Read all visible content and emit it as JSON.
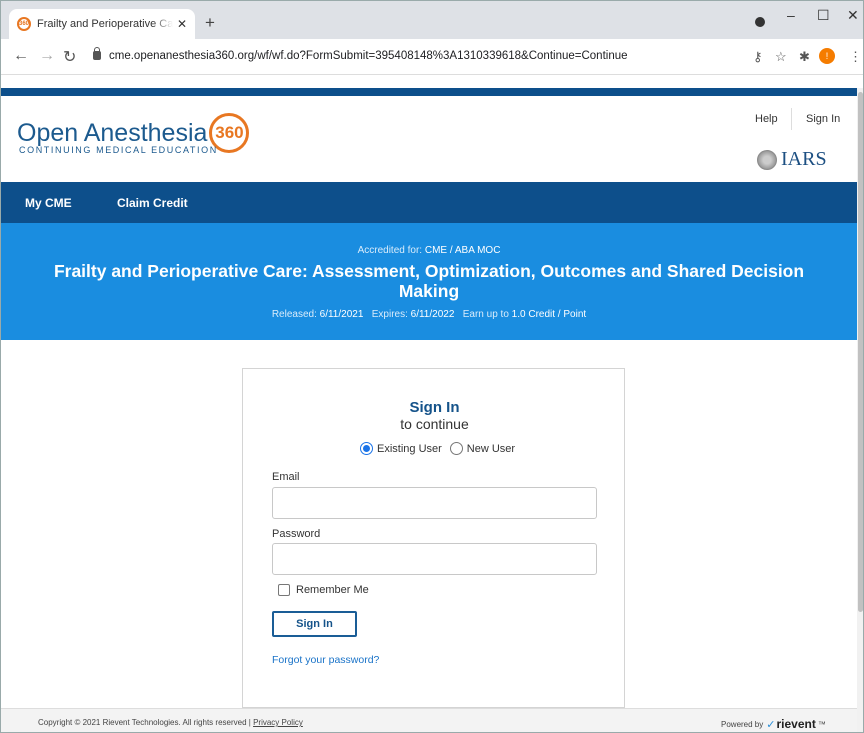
{
  "browser": {
    "tab_title": "Frailty and Perioperative Care: As",
    "tab_favicon_text": "360",
    "url": "cme.openanesthesia360.org/wf/wf.do?FormSubmit=395408148%3A1310339618&Continue=Continue",
    "profile_badge": "!",
    "window_controls": {
      "minimize": "–",
      "maximize": "☐",
      "close": "✕"
    }
  },
  "header": {
    "logo_text": "Open Anesthesia",
    "logo_badge": "360",
    "logo_subtitle": "CONTINUING MEDICAL EDUCATION",
    "help": "Help",
    "sign_in": "Sign In",
    "partner_logo": "IARS"
  },
  "nav": {
    "items": [
      "My CME",
      "Claim Credit"
    ]
  },
  "hero": {
    "accredited_label": "Accredited for:",
    "accredited_value": "CME / ABA MOC",
    "title": "Frailty and Perioperative Care: Assessment, Optimization, Outcomes and Shared Decision Making",
    "released_label": "Released:",
    "released_value": "6/11/2021",
    "expires_label": "Expires:",
    "expires_value": "6/11/2022",
    "earn_label": "Earn up to",
    "earn_value": "1.0 Credit / Point"
  },
  "signin": {
    "title": "Sign In",
    "subtitle": "to continue",
    "existing_user": "Existing User",
    "new_user": "New User",
    "email_label": "Email",
    "email_value": "",
    "password_label": "Password",
    "password_value": "",
    "remember_me": "Remember Me",
    "submit": "Sign In",
    "forgot": "Forgot your password?"
  },
  "footer": {
    "copyright": "Copyright © 2021 Rievent Technologies. All rights reserved |",
    "privacy": "Privacy Policy",
    "powered_by": "Powered by",
    "brand": "rievent",
    "tm": "™"
  },
  "colors": {
    "brand_blue": "#0d4f8b",
    "hero_blue": "#1a8de0",
    "accent_orange": "#e87722"
  }
}
